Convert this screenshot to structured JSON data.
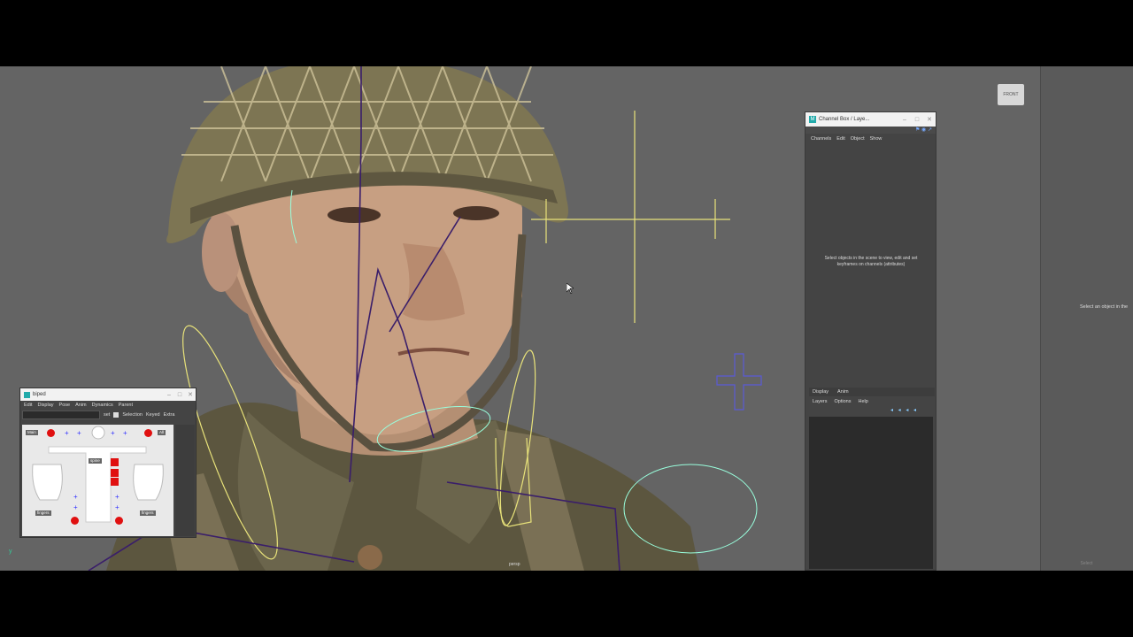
{
  "viewport": {
    "camera_label": "persp",
    "viewcube_label": "FRONT",
    "axis_label": "y"
  },
  "channel_box": {
    "title": "Channel Box / Laye...",
    "menus": [
      "Channels",
      "Edit",
      "Object",
      "Show"
    ],
    "hint": "Select objects in the scene to view, edit and set keyframes on channels (attributes)",
    "layer_tabs": [
      "Display",
      "Anim"
    ],
    "layer_menus": [
      "Layers",
      "Options",
      "Help"
    ]
  },
  "biped": {
    "title": "biped",
    "menus": [
      "Edit",
      "Display",
      "Pose",
      "Anim",
      "Dynamics",
      "Parent"
    ],
    "toolbar": {
      "set_label": "set",
      "selection_label": "Selection",
      "keyed_label": "Keyed",
      "extra_label": "Extra"
    },
    "tags": {
      "main": "Main",
      "all": "All",
      "spine": "spine",
      "fingers_left": "fingers",
      "fingers_right": "fingers"
    }
  },
  "attribute_panel": {
    "message": "Select an object in the",
    "button": "Select"
  },
  "colors": {
    "viewport_bg": "#646464",
    "control_yellow": "#e8e27a",
    "joint_purple": "#3a1e6a",
    "control_cyan": "#9fd",
    "picker_red": "#e01010"
  }
}
